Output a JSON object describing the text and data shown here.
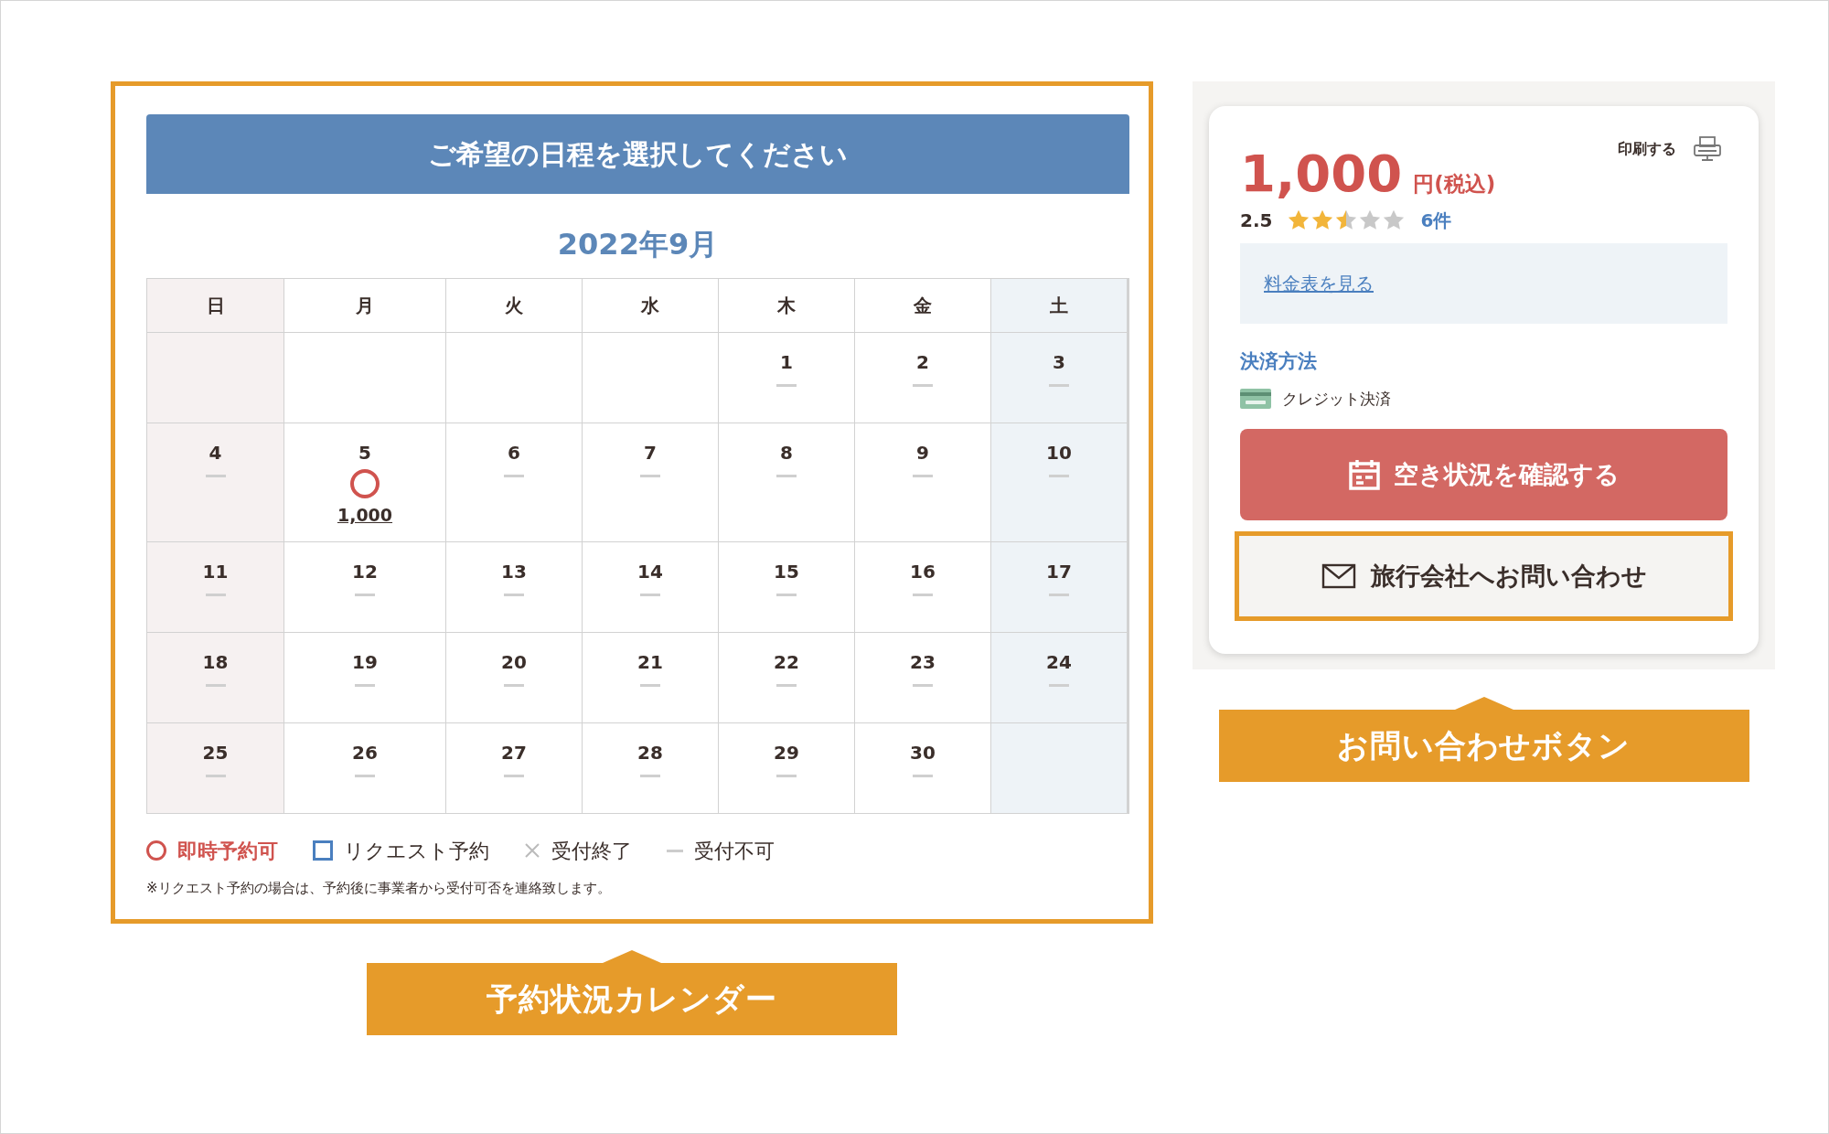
{
  "calendar": {
    "heading": "ご希望の日程を選択してください",
    "month": "2022年9月",
    "weekdays": [
      {
        "label": "日",
        "kind": "sunday"
      },
      {
        "label": "月",
        "kind": "weekday"
      },
      {
        "label": "火",
        "kind": "weekday"
      },
      {
        "label": "水",
        "kind": "weekday"
      },
      {
        "label": "木",
        "kind": "weekday"
      },
      {
        "label": "金",
        "kind": "weekday"
      },
      {
        "label": "土",
        "kind": "saturday"
      }
    ],
    "weeks": [
      [
        {
          "kind": "blank"
        },
        {
          "kind": "blank"
        },
        {
          "kind": "blank"
        },
        {
          "kind": "blank"
        },
        {
          "day": "1",
          "kind": "unavailable"
        },
        {
          "day": "2",
          "kind": "unavailable"
        },
        {
          "day": "3",
          "kind": "unavailable"
        }
      ],
      [
        {
          "day": "4",
          "kind": "unavailable"
        },
        {
          "day": "5",
          "kind": "instant",
          "price": "1,000"
        },
        {
          "day": "6",
          "kind": "unavailable"
        },
        {
          "day": "7",
          "kind": "unavailable"
        },
        {
          "day": "8",
          "kind": "unavailable"
        },
        {
          "day": "9",
          "kind": "unavailable"
        },
        {
          "day": "10",
          "kind": "unavailable"
        }
      ],
      [
        {
          "day": "11",
          "kind": "unavailable"
        },
        {
          "day": "12",
          "kind": "unavailable"
        },
        {
          "day": "13",
          "kind": "unavailable"
        },
        {
          "day": "14",
          "kind": "unavailable"
        },
        {
          "day": "15",
          "kind": "unavailable"
        },
        {
          "day": "16",
          "kind": "unavailable"
        },
        {
          "day": "17",
          "kind": "unavailable"
        }
      ],
      [
        {
          "day": "18",
          "kind": "unavailable"
        },
        {
          "day": "19",
          "kind": "unavailable"
        },
        {
          "day": "20",
          "kind": "unavailable"
        },
        {
          "day": "21",
          "kind": "unavailable"
        },
        {
          "day": "22",
          "kind": "unavailable"
        },
        {
          "day": "23",
          "kind": "unavailable"
        },
        {
          "day": "24",
          "kind": "unavailable"
        }
      ],
      [
        {
          "day": "25",
          "kind": "unavailable"
        },
        {
          "day": "26",
          "kind": "unavailable"
        },
        {
          "day": "27",
          "kind": "unavailable"
        },
        {
          "day": "28",
          "kind": "unavailable"
        },
        {
          "day": "29",
          "kind": "unavailable"
        },
        {
          "day": "30",
          "kind": "unavailable"
        },
        {
          "kind": "blank"
        }
      ]
    ],
    "legend": [
      {
        "label": "即時予約可",
        "kind": "instant"
      },
      {
        "label": "リクエスト予約",
        "kind": "request"
      },
      {
        "label": "受付終了",
        "kind": "closed"
      },
      {
        "label": "受付不可",
        "kind": "unavailable"
      }
    ],
    "note": "※リクエスト予約の場合は、予約後に事業者から受付可否を連絡致します。",
    "callout": "予約状況カレンダー"
  },
  "booking": {
    "print": "印刷する",
    "price": "1,000",
    "price_unit": "円(税込)",
    "rating": {
      "score": "2.5",
      "stars": 2.5,
      "count": "6件"
    },
    "price_table_link": "料金表を見る",
    "payment_heading": "決済方法",
    "payment_method": "クレジット決済",
    "availability_button": "空き状況を確認する",
    "contact_button": "旅行会社へお問い合わせ",
    "callout": "お問い合わせボタン"
  }
}
